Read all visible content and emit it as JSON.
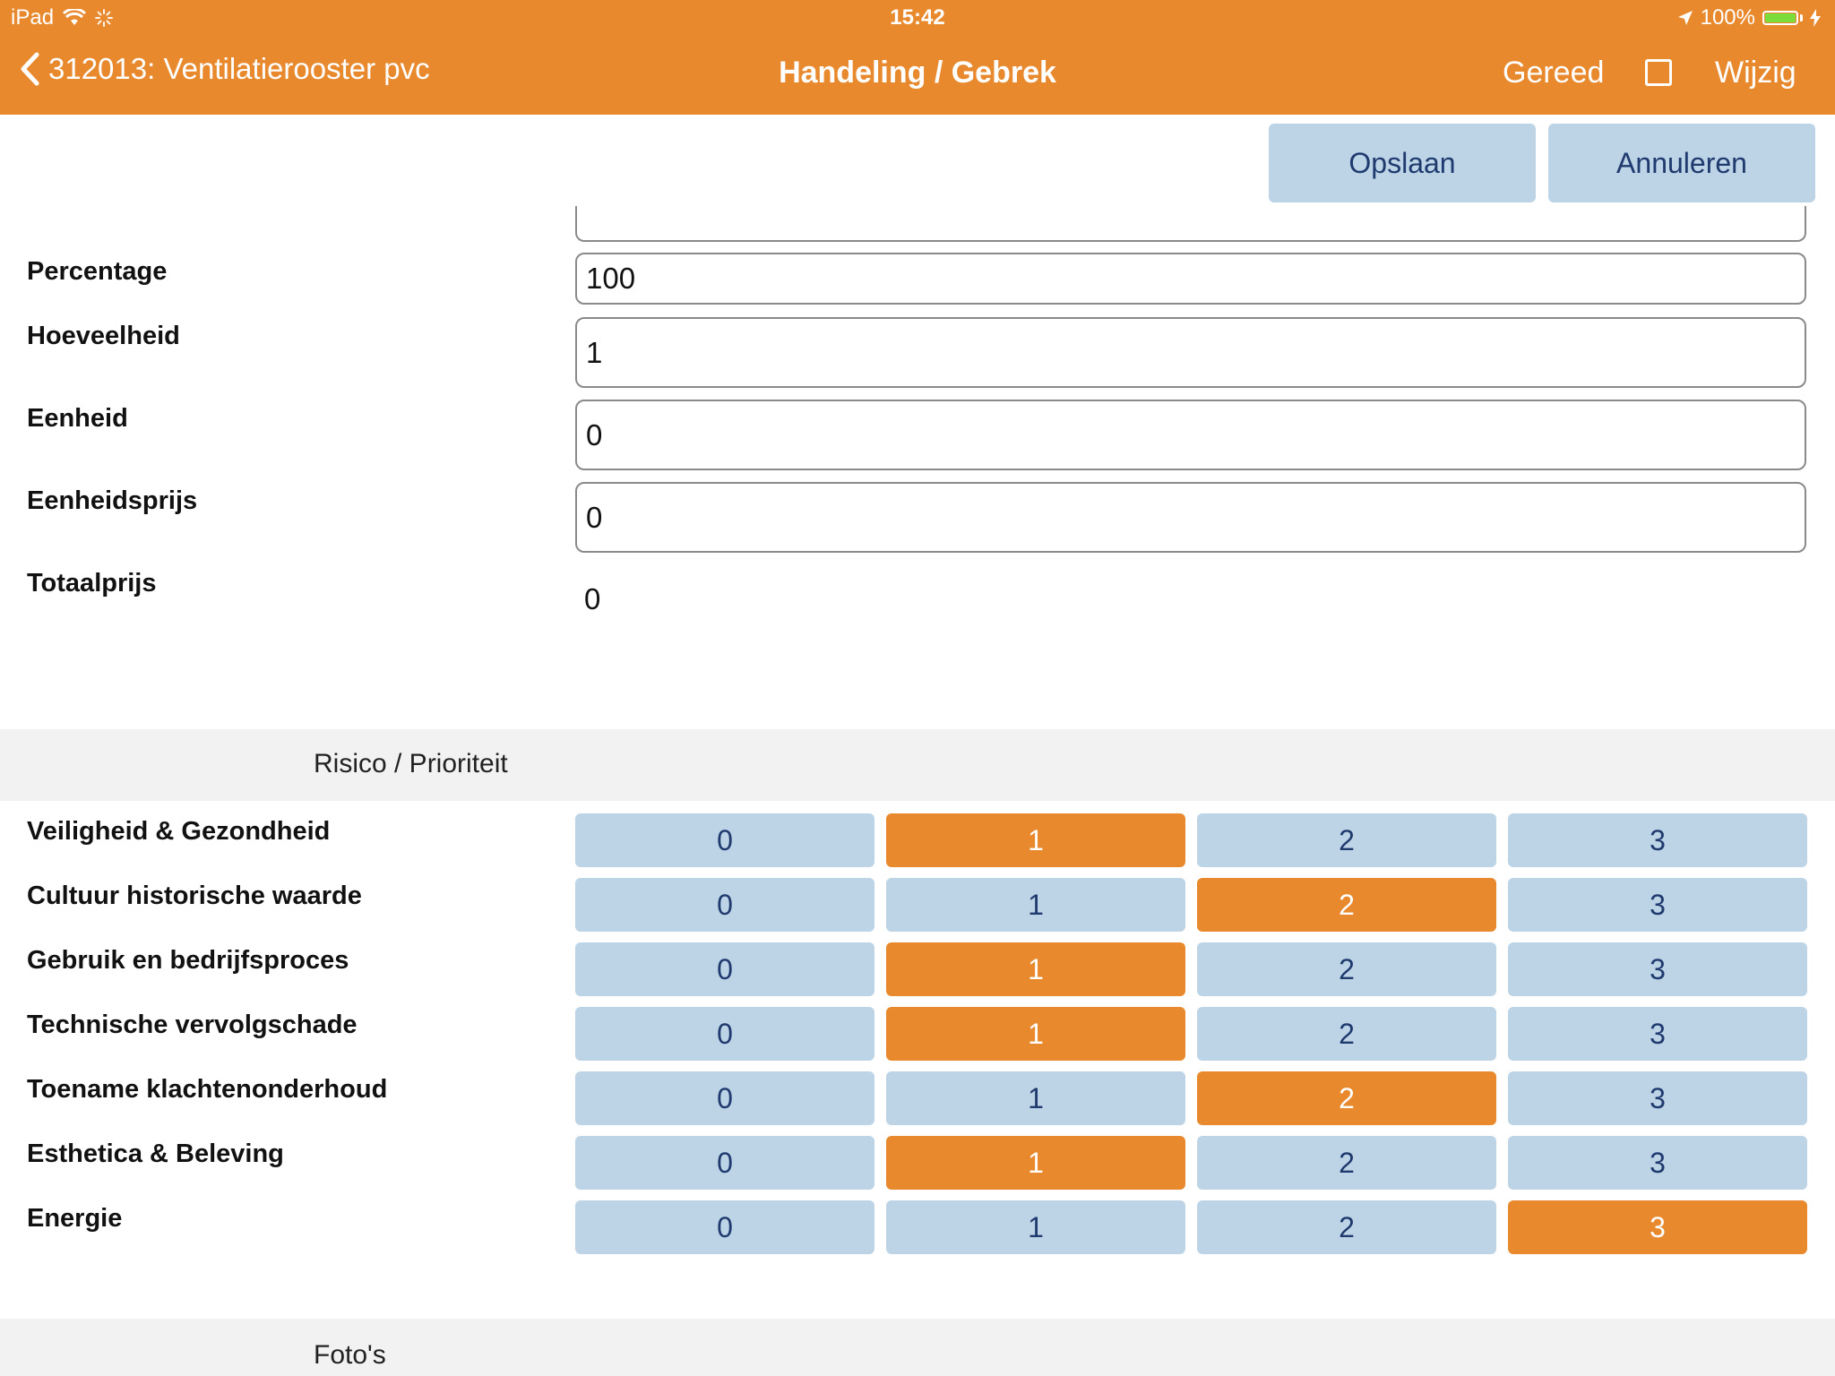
{
  "status_bar": {
    "device": "iPad",
    "time": "15:42",
    "battery": "100%",
    "battery_level": 1.0
  },
  "nav": {
    "back_label": "312013: Ventilatierooster pvc",
    "title": "Handeling / Gebrek",
    "done_label": "Gereed",
    "edit_label": "Wijzig"
  },
  "actions": {
    "save_label": "Opslaan",
    "cancel_label": "Annuleren"
  },
  "form": {
    "percentage": {
      "label": "Percentage",
      "value": "100"
    },
    "quantity": {
      "label": "Hoeveelheid",
      "value": "1"
    },
    "unit": {
      "label": "Eenheid",
      "value": "0"
    },
    "unit_price": {
      "label": "Eenheidsprijs",
      "value": "0"
    },
    "total_price": {
      "label": "Totaalprijs",
      "value": "0"
    }
  },
  "risk_section": {
    "title": "Risico / Prioriteit",
    "options": [
      "0",
      "1",
      "2",
      "3"
    ],
    "rows": [
      {
        "label": "Veiligheid & Gezondheid",
        "selected": 1
      },
      {
        "label": "Cultuur historische waarde",
        "selected": 2
      },
      {
        "label": "Gebruik en bedrijfsproces",
        "selected": 1
      },
      {
        "label": "Technische vervolgschade",
        "selected": 1
      },
      {
        "label": "Toename klachtenonderhoud",
        "selected": 2
      },
      {
        "label": "Esthetica & Beleving",
        "selected": 1
      },
      {
        "label": "Energie",
        "selected": 3
      }
    ]
  },
  "photos_section": {
    "title": "Foto's"
  },
  "colors": {
    "accent": "#e8892e",
    "button_bg": "#bdd3e6",
    "button_text": "#1f3a6e"
  }
}
